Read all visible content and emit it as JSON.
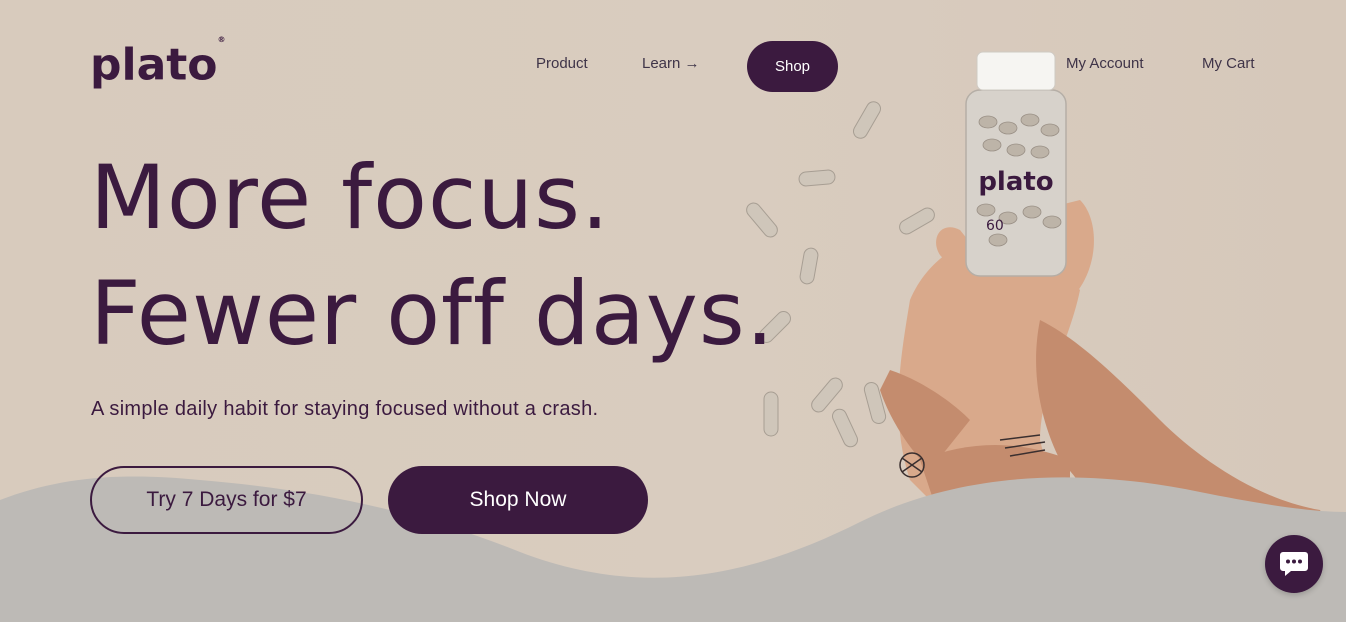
{
  "brand": {
    "logo_text": "plato",
    "logo_mark": "®"
  },
  "nav": {
    "product": "Product",
    "learn": "Learn →",
    "shop": "Shop",
    "account": "My Account",
    "cart": "My Cart"
  },
  "hero": {
    "headline_line1": "More focus.",
    "headline_line2": "Fewer off days.",
    "subtext": "A simple daily habit for staying focused without a crash.",
    "cta_trial": "Try 7 Days for $7",
    "cta_shop": "Shop Now"
  },
  "product_image": {
    "bottle_brand": "plato",
    "bottle_count": "60"
  },
  "colors": {
    "brand": "#3b1a3f",
    "background": "#d9ccbe",
    "wave": "#bdbab6"
  },
  "icons": {
    "chat": "chat-bubble-icon"
  }
}
